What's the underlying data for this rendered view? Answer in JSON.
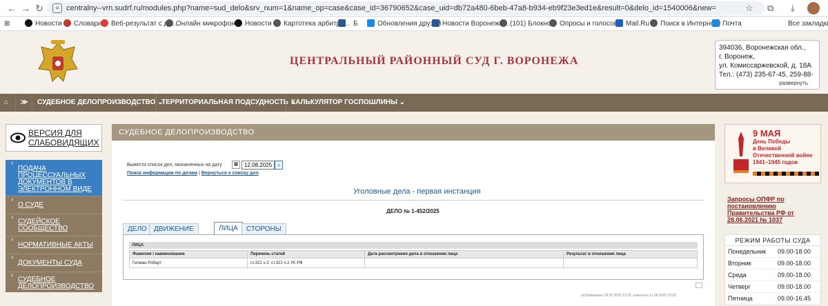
{
  "browser": {
    "url": "centralny--vrn.sudrf.ru/modules.php?name=sud_delo&srv_num=1&name_op=case&case_id=36790652&case_uid=db72a480-6beb-47a8-b934-eb9f23e3ed1e&result=0&delo_id=1540006&new=",
    "bookmarks": [
      "Новости",
      "Словари",
      "Веб-результат с до...",
      "Онлайн микрофон...",
      "Новости",
      "Картотека арбитра...",
      "Б",
      "Обновления друзей",
      "Новости Воронежа...",
      "(101) Блокнот",
      "Опросы и голосов...",
      "Mail.Ru",
      "Поиск в Интернете",
      "Почта",
      "Все закладки"
    ]
  },
  "header": {
    "title": "ЦЕНТРАЛЬНЫЙ РАЙОННЫЙ СУД Г. ВОРОНЕЖА",
    "contact_lines": [
      "394036, Воронежская обл.,",
      "г. Воронеж,",
      "ул. Комиссаржевской, д. 18А",
      "Тел.: (473) 235-67-45, 259-88-"
    ],
    "expand": "развернуть"
  },
  "menu": {
    "items": [
      "СУДЕБНОЕ ДЕЛОПРОИЗВОДСТВО",
      "ТЕРРИТОРИАЛЬНАЯ ПОДСУДНОСТЬ",
      "КАЛЬКУЛЯТОР ГОСПОШЛИНЫ"
    ]
  },
  "left": {
    "vision": [
      "ВЕРСИЯ ДЛЯ",
      "СЛАБОВИДЯЩИХ"
    ],
    "nav": [
      {
        "label": "ПОДАЧА ПРОЦЕССУАЛЬНЫХ ДОКУМЕНТОВ В ЭЛЕКТРОННОМ ВИДЕ"
      },
      {
        "label": "О СУДЕ"
      },
      {
        "label": "СУДЕЙСКОЕ СООБЩЕСТВО"
      },
      {
        "label": "НОРМАТИВНЫЕ АКТЫ"
      },
      {
        "label": "ДОКУМЕНТЫ СУДА"
      },
      {
        "label": "СУДЕБНОЕ ДЕЛОПРОИЗВОДСТВО"
      }
    ]
  },
  "content": {
    "section_header": "СУДЕБНОЕ ДЕЛОПРОИЗВОДСТВО",
    "date_label": "Вывести список дел, назначенных на дату",
    "date_value": "12.08.2025",
    "link_search": "Поиск информации по делам",
    "link_sep": "|",
    "link_back": "Вернуться к списку дел",
    "instance_title": "Уголовные дела - первая инстанция",
    "case_number": "ДЕЛО № 1-452/2025",
    "tabs": [
      "ДЕЛО",
      "ДВИЖЕНИЕ ДЕЛА",
      "ЛИЦА",
      "СТОРОНЫ"
    ],
    "panel_caption": "ЛИЦА",
    "table": {
      "headers": [
        "Фамилия / наименование",
        "Перечень статей",
        "Дата рассмотрения дела в отношении лица",
        "Результат в отношении лица"
      ],
      "rows": [
        [
          "Гилман Роберт",
          "ст.321 ч.2; ст.321 ч.2 УК РФ",
          "",
          ""
        ]
      ]
    },
    "footer_note": "опубликовано 29.07.2025 13:39, изменено 11.08.2025 18:03"
  },
  "right": {
    "banner": [
      "9 МАЯ",
      "День Победы",
      "в Великой",
      "Отечественной войне",
      "1941–1945 годов"
    ],
    "opfr": "Запросы ОПФР по постановлению Правительства РФ от 28.06.2021 № 1037",
    "schedule_title": "РЕЖИМ РАБОТЫ СУДА",
    "schedule": [
      {
        "day": "Понедельник",
        "time": "09.00-18.00"
      },
      {
        "day": "Вторник",
        "time": "09.00-18.00"
      },
      {
        "day": "Среда",
        "time": "09.00-18.00"
      },
      {
        "day": "Четверг",
        "time": "09.00-18.00"
      },
      {
        "day": "Пятница",
        "time": "09.00-16.45"
      }
    ]
  }
}
